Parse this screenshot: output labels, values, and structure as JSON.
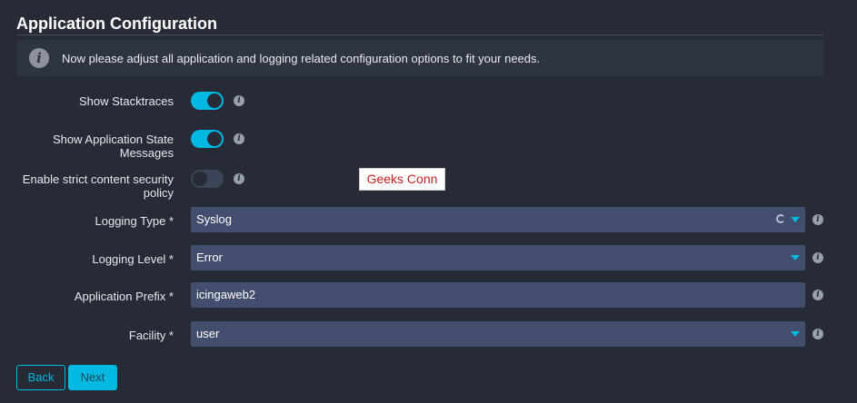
{
  "page": {
    "title": "Application Configuration",
    "info": "Now please adjust all application and logging related configuration options to fit your needs."
  },
  "fields": {
    "show_stacktraces": {
      "label": "Show Stacktraces",
      "state": "on"
    },
    "show_app_state": {
      "label_line1": "Show Application State",
      "label_line2": "Messages",
      "state": "on"
    },
    "strict_csp": {
      "label_line1": "Enable strict content security",
      "label_line2": "policy",
      "state": "off"
    },
    "logging_type": {
      "label": "Logging Type *",
      "value": "Syslog"
    },
    "logging_level": {
      "label": "Logging Level *",
      "value": "Error"
    },
    "application_prefix": {
      "label": "Application Prefix *",
      "value": "icingaweb2"
    },
    "facility": {
      "label": "Facility *",
      "value": "user"
    }
  },
  "watermark": "Geeks Conn",
  "buttons": {
    "back": "Back",
    "next": "Next"
  },
  "colors": {
    "accent": "#00b8e0",
    "background": "#262b36",
    "field": "#434e6f"
  },
  "icons": {
    "info": "info-circle-icon",
    "help": "help-icon",
    "reload": "reload-icon",
    "dropdown": "chevron-down-icon"
  }
}
